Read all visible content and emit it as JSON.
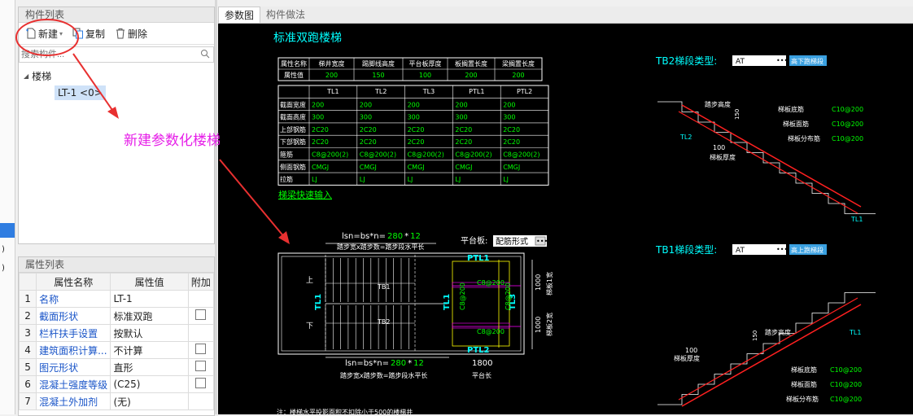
{
  "left_strip": {
    "row1": ")",
    "row2": ")"
  },
  "component_panel": {
    "title": "构件列表",
    "toolbar": {
      "new": "新建",
      "copy": "复制",
      "delete": "删除"
    },
    "search_placeholder": "搜索构件...",
    "tree": {
      "root": "楼梯",
      "child": "LT-1 <0>"
    }
  },
  "property_panel": {
    "title": "属性列表",
    "columns": [
      "属性名称",
      "属性值",
      "附加"
    ],
    "rows": [
      {
        "num": "1",
        "name": "名称",
        "value": "LT-1",
        "check": false
      },
      {
        "num": "2",
        "name": "截面形状",
        "value": "标准双跑",
        "check": true
      },
      {
        "num": "3",
        "name": "栏杆扶手设置",
        "value": "按默认",
        "check": false
      },
      {
        "num": "4",
        "name": "建筑面积计算...",
        "value": "不计算",
        "check": true
      },
      {
        "num": "5",
        "name": "图元形状",
        "value": "直形",
        "check": true
      },
      {
        "num": "6",
        "name": "混凝土强度等级",
        "value": "(C25)",
        "check": true
      },
      {
        "num": "7",
        "name": "混凝土外加剂",
        "value": "(无)",
        "check": false
      }
    ]
  },
  "tabs": [
    "参数图",
    "构件做法"
  ],
  "annotation": {
    "text": "新建参数化楼梯",
    "color": "#e61ee8"
  },
  "drawing": {
    "title": "标准双跑楼梯",
    "table1": {
      "headers": [
        "属性名称",
        "梯井宽度",
        "踢脚线高度",
        "平台板厚度",
        "板搁置长度",
        "梁搁置长度"
      ],
      "row_label": "属性值",
      "values": [
        "200",
        "150",
        "100",
        "200",
        "200"
      ]
    },
    "table2": {
      "columns": [
        "TL1",
        "TL2",
        "TL3",
        "PTL1",
        "PTL2"
      ],
      "rows": [
        {
          "label": "截面宽度",
          "values": [
            "200",
            "200",
            "200",
            "200",
            "200"
          ]
        },
        {
          "label": "截面高度",
          "values": [
            "300",
            "300",
            "300",
            "300",
            "300"
          ]
        },
        {
          "label": "上部钢筋",
          "values": [
            "2C20",
            "2C20",
            "2C20",
            "2C20",
            "2C20"
          ]
        },
        {
          "label": "下部钢筋",
          "values": [
            "2C20",
            "2C20",
            "2C20",
            "2C20",
            "2C20"
          ]
        },
        {
          "label": "箍筋",
          "values": [
            "C8@200(2)",
            "C8@200(2)",
            "C8@200(2)",
            "C8@200(2)",
            "C8@200(2)"
          ]
        },
        {
          "label": "侧面钢筋",
          "values": [
            "CMGJ",
            "CMGJ",
            "CMGJ",
            "CMGJ",
            "CMGJ"
          ]
        },
        {
          "label": "拉筋",
          "values": [
            "LJ",
            "LJ",
            "LJ",
            "LJ",
            "LJ"
          ]
        }
      ]
    },
    "quick_input": "梯梁快速输入",
    "plan": {
      "lsn_label": "lsn=bs*n=",
      "lsn_bs": "280",
      "lsn_n": "12",
      "tread_desc": "踏步宽x踏步数=踏步段水平长",
      "platform_label": "平台板:",
      "platform_value": "配筋形式",
      "up": "上",
      "down": "下",
      "tb1": "TB1",
      "tb2": "TB2",
      "tl1": "TL1",
      "tl3": "TL3",
      "ptl1": "PTL1",
      "ptl2": "PTL2",
      "c8a": "C8@200",
      "c8b": "C8@200",
      "c8c": "C8@200",
      "c8d": "C8@200",
      "dim_1000a": "1000",
      "dim_1000b": "1000",
      "w1": "梯板1宽",
      "w2": "梯板2宽",
      "dim_1800": "1800",
      "platform_len": "平台长"
    },
    "tb2": {
      "label": "TB2梯段类型:",
      "value": "AT",
      "btn": "高下跑梯段",
      "tread_h": "踏步高度",
      "dim150": "150",
      "bottom_rebar": "梯板底筋",
      "bottom_val": "C10@200",
      "top_rebar": "梯板面筋",
      "top_val": "C10@200",
      "dist_rebar": "梯板分布筋",
      "dist_val": "C10@200",
      "dim100": "100",
      "thickness": "梯板厚度",
      "tl2": "TL2",
      "tl1": "TL1"
    },
    "tb1": {
      "label": "TB1梯段类型:",
      "value": "AT",
      "btn": "高上跑梯段",
      "tread_h": "踏步高度",
      "dim150": "150",
      "dim100": "100",
      "thickness": "梯板厚度",
      "tl1": "TL1",
      "bottom_rebar": "梯板底筋",
      "bottom_val": "C10@200",
      "top_rebar": "梯板面筋",
      "top_val": "C10@200",
      "dist_rebar": "梯板分布筋",
      "dist_val": "C10@200"
    },
    "note": "注：楼梯水平投影面积不扣除小于500的楼梯井"
  },
  "colors": {
    "canvas_bg": "#000000",
    "cad_white": "#ffffff",
    "cad_green": "#00ff00",
    "cad_cyan": "#00ffff",
    "cad_yellow": "#ffff00",
    "cad_red": "#ff2020",
    "accent_blue": "#1a55c8"
  }
}
